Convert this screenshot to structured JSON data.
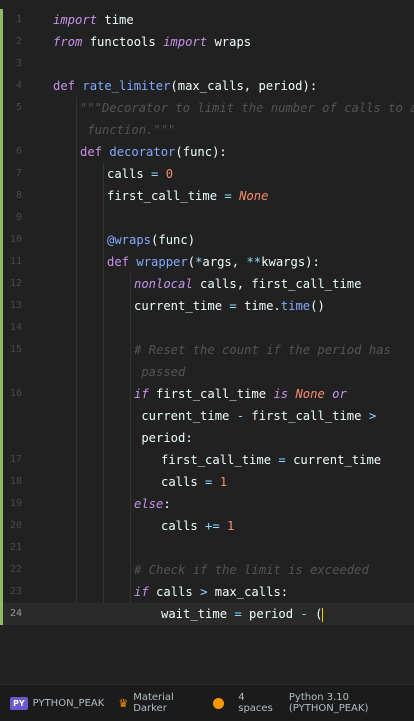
{
  "editor": {
    "current_line": 24,
    "lines": [
      {
        "n": "1",
        "indent": 0,
        "t": [
          [
            "kw",
            "import"
          ],
          [
            "plain",
            " time"
          ]
        ]
      },
      {
        "n": "2",
        "indent": 0,
        "t": [
          [
            "kw",
            "from"
          ],
          [
            "plain",
            " functools "
          ],
          [
            "kw",
            "import"
          ],
          [
            "plain",
            " wraps"
          ]
        ]
      },
      {
        "n": "3",
        "indent": 0,
        "t": []
      },
      {
        "n": "4",
        "indent": 0,
        "t": [
          [
            "def",
            "def "
          ],
          [
            "fn",
            "rate_limiter"
          ],
          [
            "plain",
            "(max_calls, period):"
          ]
        ]
      },
      {
        "n": "5",
        "indent": 1,
        "t": [
          [
            "str",
            "\"\"\"Decorator to limit the number of calls to a"
          ]
        ]
      },
      {
        "n": "",
        "indent": 1,
        "t": [
          [
            "str",
            " function.\"\"\""
          ]
        ]
      },
      {
        "n": "6",
        "indent": 1,
        "t": [
          [
            "def",
            "def "
          ],
          [
            "fn",
            "decorator"
          ],
          [
            "plain",
            "(func):"
          ]
        ]
      },
      {
        "n": "7",
        "indent": 2,
        "t": [
          [
            "plain",
            "calls "
          ],
          [
            "op",
            "="
          ],
          [
            "num",
            " 0"
          ]
        ]
      },
      {
        "n": "8",
        "indent": 2,
        "t": [
          [
            "plain",
            "first_call_time "
          ],
          [
            "op",
            "="
          ],
          [
            "const",
            " None"
          ]
        ]
      },
      {
        "n": "9",
        "indent": 0,
        "t": []
      },
      {
        "n": "10",
        "indent": 2,
        "t": [
          [
            "dec",
            "@wraps"
          ],
          [
            "plain",
            "(func)"
          ]
        ]
      },
      {
        "n": "11",
        "indent": 2,
        "t": [
          [
            "def",
            "def "
          ],
          [
            "fn",
            "wrapper"
          ],
          [
            "plain",
            "("
          ],
          [
            "op",
            "*"
          ],
          [
            "plain",
            "args, "
          ],
          [
            "op",
            "**"
          ],
          [
            "plain",
            "kwargs):"
          ]
        ]
      },
      {
        "n": "12",
        "indent": 3,
        "t": [
          [
            "kw",
            "nonlocal"
          ],
          [
            "plain",
            " calls, first_call_time"
          ]
        ]
      },
      {
        "n": "13",
        "indent": 3,
        "t": [
          [
            "plain",
            "current_time "
          ],
          [
            "op",
            "="
          ],
          [
            "plain",
            " time."
          ],
          [
            "fn",
            "time"
          ],
          [
            "plain",
            "()"
          ]
        ]
      },
      {
        "n": "14",
        "indent": 0,
        "t": []
      },
      {
        "n": "15",
        "indent": 3,
        "t": [
          [
            "cmt",
            "# Reset the count if the period has"
          ]
        ]
      },
      {
        "n": "",
        "indent": 3,
        "t": [
          [
            "cmt",
            " passed"
          ]
        ]
      },
      {
        "n": "16",
        "indent": 3,
        "t": [
          [
            "kw",
            "if"
          ],
          [
            "plain",
            " first_call_time "
          ],
          [
            "kw",
            "is"
          ],
          [
            "const",
            " None"
          ],
          [
            "kw",
            " or"
          ]
        ]
      },
      {
        "n": "",
        "indent": 3,
        "t": [
          [
            "plain",
            " current_time "
          ],
          [
            "op",
            "-"
          ],
          [
            "plain",
            " first_call_time "
          ],
          [
            "op",
            ">"
          ]
        ]
      },
      {
        "n": "",
        "indent": 3,
        "t": [
          [
            "plain",
            " period:"
          ]
        ]
      },
      {
        "n": "17",
        "indent": 4,
        "t": [
          [
            "plain",
            "first_call_time "
          ],
          [
            "op",
            "="
          ],
          [
            "plain",
            " current_time"
          ]
        ]
      },
      {
        "n": "18",
        "indent": 4,
        "t": [
          [
            "plain",
            "calls "
          ],
          [
            "op",
            "="
          ],
          [
            "num",
            " 1"
          ]
        ]
      },
      {
        "n": "19",
        "indent": 3,
        "t": [
          [
            "kw",
            "else"
          ],
          [
            "plain",
            ":"
          ]
        ]
      },
      {
        "n": "20",
        "indent": 4,
        "t": [
          [
            "plain",
            "calls "
          ],
          [
            "op",
            "+="
          ],
          [
            "num",
            " 1"
          ]
        ]
      },
      {
        "n": "21",
        "indent": 0,
        "t": []
      },
      {
        "n": "22",
        "indent": 3,
        "t": [
          [
            "cmt",
            "# Check if the limit is exceeded"
          ]
        ]
      },
      {
        "n": "23",
        "indent": 3,
        "t": [
          [
            "kw",
            "if"
          ],
          [
            "plain",
            " calls "
          ],
          [
            "op",
            ">"
          ],
          [
            "plain",
            " max_calls:"
          ]
        ]
      },
      {
        "n": "24",
        "indent": 4,
        "t": [
          [
            "plain",
            "wait_time "
          ],
          [
            "op",
            "="
          ],
          [
            "plain",
            " period "
          ],
          [
            "op",
            "-"
          ],
          [
            "plain",
            " ("
          ]
        ]
      }
    ]
  },
  "statusbar": {
    "project_badge": "PY",
    "project_name": "PYTHON_PEAK",
    "theme_name": "Material Darker",
    "indent": "4 spaces",
    "interpreter": "Python 3.10 (PYTHON_PEAK)"
  },
  "colors": {
    "background": "#212121",
    "keyword": "#c792ea",
    "function": "#82aaff",
    "number": "#f78c6c",
    "comment": "#545454",
    "modified_marker": "#8fbc62"
  }
}
